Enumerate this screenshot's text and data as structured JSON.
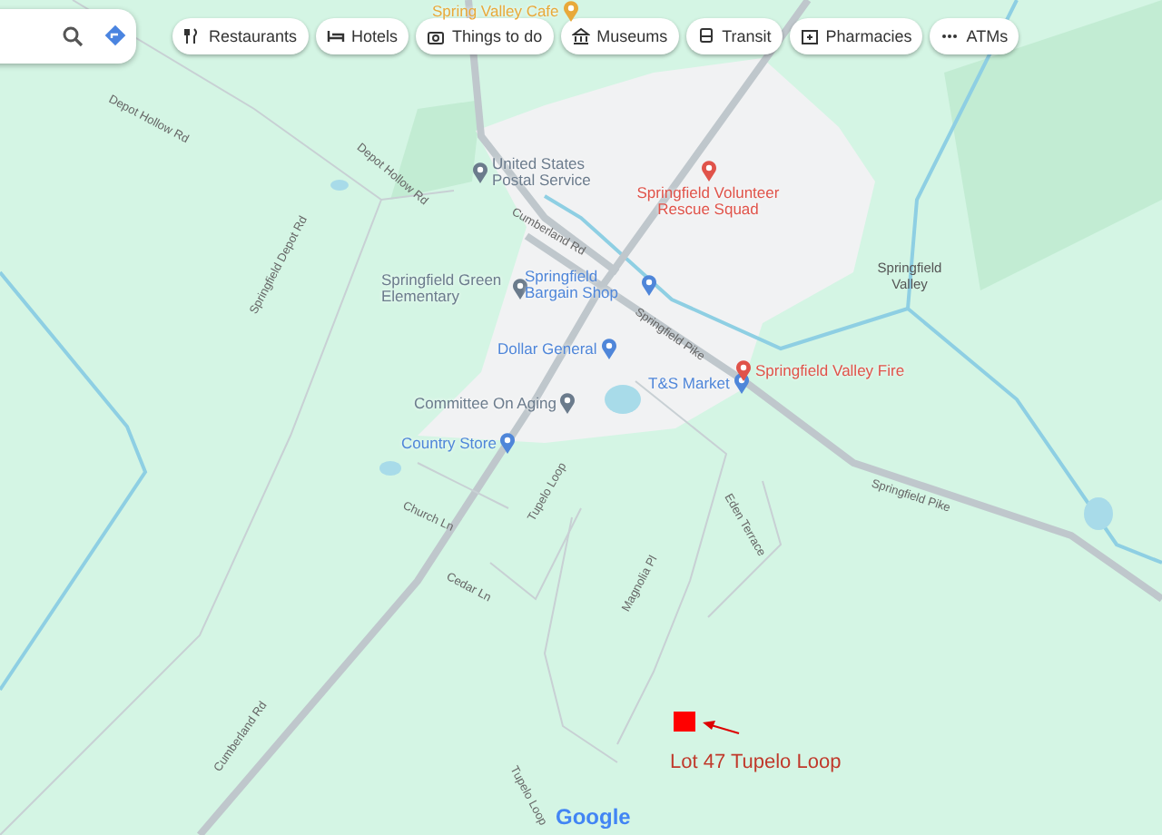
{
  "chips": [
    {
      "label": "Restaurants"
    },
    {
      "label": "Hotels"
    },
    {
      "label": "Things to do"
    },
    {
      "label": "Museums"
    },
    {
      "label": "Transit"
    },
    {
      "label": "Pharmacies"
    },
    {
      "label": "ATMs"
    }
  ],
  "places": [
    {
      "name": "Spring Valley Cafe",
      "color": "#e8a93a"
    },
    {
      "name": "United States Postal Service",
      "color": "#6b7b8c"
    },
    {
      "name": "Springfield Volunteer Rescue Squad",
      "color": "#e0534a"
    },
    {
      "name": "Springfield Green Elementary",
      "color": "#6b7b8c"
    },
    {
      "name": "Springfield Bargain Shop",
      "color": "#4f86d9"
    },
    {
      "name": "Dollar General",
      "color": "#4f86d9"
    },
    {
      "name": "Committee On Aging",
      "color": "#6b7b8c"
    },
    {
      "name": "T&S Market",
      "color": "#4f86d9"
    },
    {
      "name": "Springfield Valley Fire",
      "color": "#e0534a"
    },
    {
      "name": "Country Store",
      "color": "#4f86d9"
    }
  ],
  "areas": [
    "Springfield Valley"
  ],
  "roads": [
    "Depot Hollow Rd",
    "Depot Hollow Rd",
    "Springfield Depot Rd",
    "Cumberland Rd",
    "Springfield Pike",
    "Church Ln",
    "Cedar Ln",
    "Tupelo Loop",
    "Magnolia Pl",
    "Eden Terrace",
    "Springfield Pike",
    "Tupelo Loop",
    "Cumberland Rd"
  ],
  "marker": {
    "label": "Lot 47 Tupelo Loop"
  },
  "logo": "Google"
}
